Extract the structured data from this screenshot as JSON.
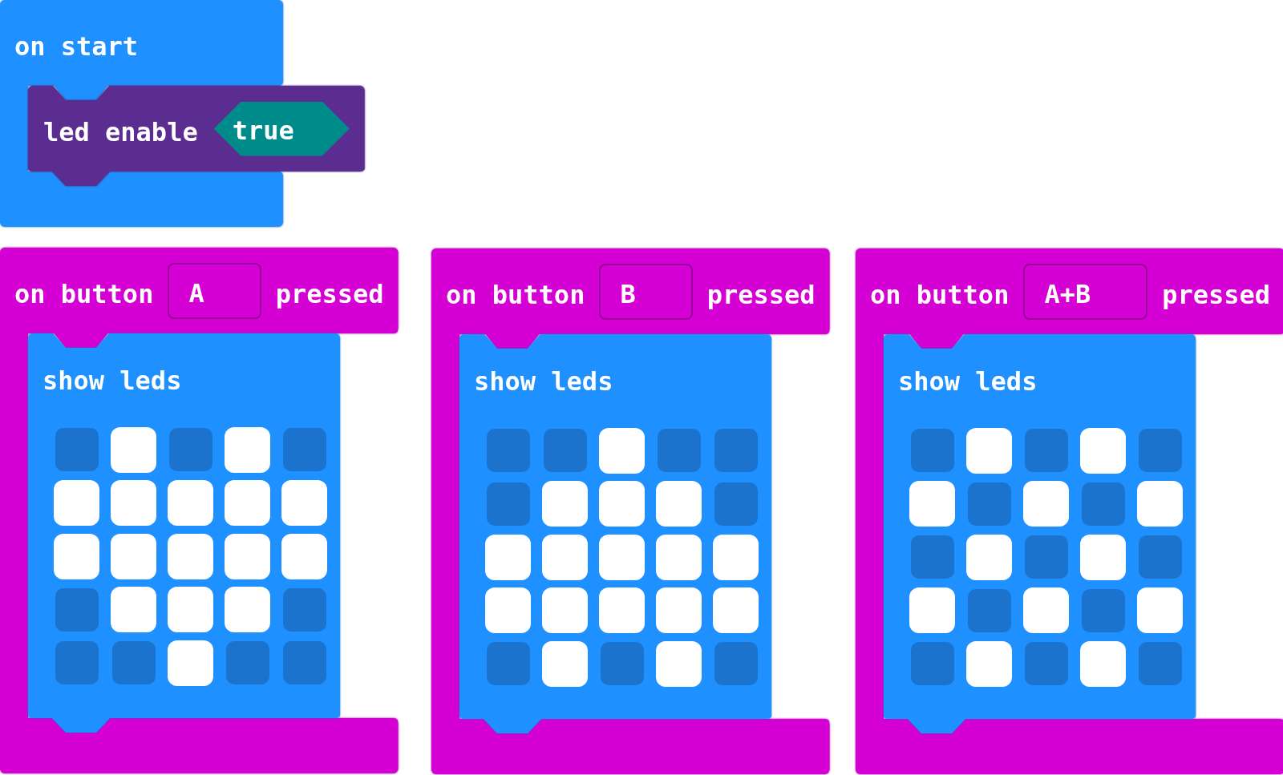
{
  "blocks": [
    {
      "kind": "event",
      "color": "#1e90ff",
      "parts": [
        {
          "kind": "label",
          "text": "on start"
        }
      ],
      "body": [
        {
          "kind": "statement",
          "color": "#5c2d91",
          "parts": [
            {
              "kind": "label",
              "text": "led enable"
            },
            {
              "kind": "boolean",
              "text": "true",
              "color": "#008b8b"
            }
          ]
        }
      ]
    },
    {
      "kind": "event",
      "color": "#d400d4",
      "parts": [
        {
          "kind": "label",
          "text": "on button"
        },
        {
          "kind": "dropdown",
          "text": "A"
        },
        {
          "kind": "label",
          "text": "pressed"
        }
      ],
      "body": [
        {
          "kind": "show_leds",
          "color": "#1e90ff",
          "parts": [
            {
              "kind": "label",
              "text": "show leds"
            }
          ],
          "leds": [
            [
              {
                "on": false
              },
              {
                "on": true
              },
              {
                "on": false
              },
              {
                "on": true
              },
              {
                "on": false
              }
            ],
            [
              {
                "on": true
              },
              {
                "on": true
              },
              {
                "on": true
              },
              {
                "on": true
              },
              {
                "on": true
              }
            ],
            [
              {
                "on": true
              },
              {
                "on": true
              },
              {
                "on": true
              },
              {
                "on": true
              },
              {
                "on": true
              }
            ],
            [
              {
                "on": false
              },
              {
                "on": true
              },
              {
                "on": true
              },
              {
                "on": true
              },
              {
                "on": false
              }
            ],
            [
              {
                "on": false
              },
              {
                "on": false
              },
              {
                "on": true
              },
              {
                "on": false
              },
              {
                "on": false
              }
            ]
          ]
        }
      ]
    },
    {
      "kind": "event",
      "color": "#d400d4",
      "parts": [
        {
          "kind": "label",
          "text": "on button"
        },
        {
          "kind": "dropdown",
          "text": "B"
        },
        {
          "kind": "label",
          "text": "pressed"
        }
      ],
      "body": [
        {
          "kind": "show_leds",
          "color": "#1e90ff",
          "parts": [
            {
              "kind": "label",
              "text": "show leds"
            }
          ],
          "leds": [
            [
              {
                "on": false
              },
              {
                "on": false
              },
              {
                "on": true
              },
              {
                "on": false
              },
              {
                "on": false
              }
            ],
            [
              {
                "on": false
              },
              {
                "on": true
              },
              {
                "on": true
              },
              {
                "on": true
              },
              {
                "on": false
              }
            ],
            [
              {
                "on": true
              },
              {
                "on": true
              },
              {
                "on": true
              },
              {
                "on": true
              },
              {
                "on": true
              }
            ],
            [
              {
                "on": true
              },
              {
                "on": true
              },
              {
                "on": true
              },
              {
                "on": true
              },
              {
                "on": true
              }
            ],
            [
              {
                "on": false
              },
              {
                "on": true
              },
              {
                "on": false
              },
              {
                "on": true
              },
              {
                "on": false
              }
            ]
          ]
        }
      ]
    },
    {
      "kind": "event",
      "color": "#d400d4",
      "parts": [
        {
          "kind": "label",
          "text": "on button"
        },
        {
          "kind": "dropdown",
          "text": "A+B"
        },
        {
          "kind": "label",
          "text": "pressed"
        }
      ],
      "body": [
        {
          "kind": "show_leds",
          "color": "#1e90ff",
          "parts": [
            {
              "kind": "label",
              "text": "show leds"
            }
          ],
          "leds": [
            [
              {
                "on": false
              },
              {
                "on": true
              },
              {
                "on": false
              },
              {
                "on": true
              },
              {
                "on": false
              }
            ],
            [
              {
                "on": true
              },
              {
                "on": false
              },
              {
                "on": true
              },
              {
                "on": false
              },
              {
                "on": true
              }
            ],
            [
              {
                "on": false
              },
              {
                "on": true
              },
              {
                "on": false
              },
              {
                "on": true
              },
              {
                "on": false
              }
            ],
            [
              {
                "on": true
              },
              {
                "on": false
              },
              {
                "on": true
              },
              {
                "on": false
              },
              {
                "on": true
              }
            ],
            [
              {
                "on": false
              },
              {
                "on": true
              },
              {
                "on": false
              },
              {
                "on": true
              },
              {
                "on": false
              }
            ]
          ]
        }
      ]
    }
  ]
}
